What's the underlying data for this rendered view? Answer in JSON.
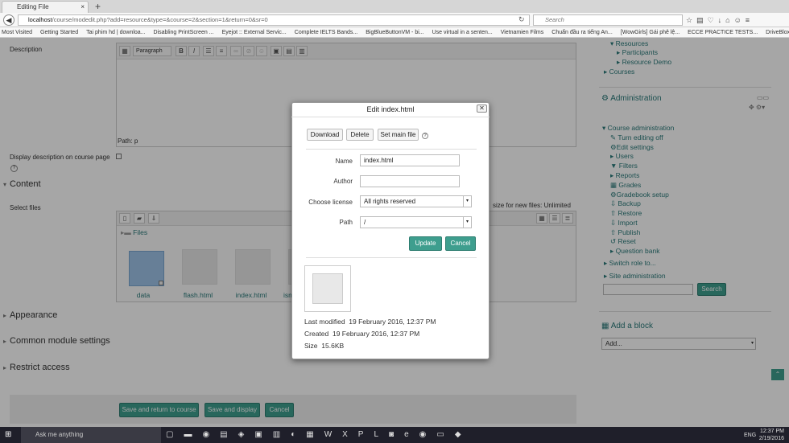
{
  "browser": {
    "tab_title": "Editing File",
    "tab_close": "×",
    "new_tab": "+",
    "url_host": "localhost",
    "url_path": "/course/modedit.php?add=resource&type=&course=2&section=1&return=0&sr=0",
    "search_placeholder": "Search",
    "bookmarks": [
      "Most Visited",
      "Getting Started",
      "Tai phim hd | downloa...",
      "Disabling PrintScreen ...",
      "Eyejot :: External Servic...",
      "Complete IELTS Bands...",
      "BigBlueButtonVM - bi...",
      "Use virtual in a senten...",
      "Vietnamien Films",
      "Chuẩn đầu ra tiếng An...",
      "[WowGirls] Gái phê lệ...",
      "ECCE PRACTICE TESTS...",
      "DriveBlox Unlimited, a ..."
    ]
  },
  "form": {
    "description_label": "Description",
    "paragraph_select": "Paragraph",
    "editor_path": "Path: p",
    "display_desc_label": "Display description on course page",
    "content_heading": "Content",
    "select_files_label": "Select files",
    "max_size_text": "size for new files: Unlimited",
    "files_folder": "Files",
    "files": [
      {
        "name": "data",
        "kind": "folder"
      },
      {
        "name": "flash.html",
        "kind": "file"
      },
      {
        "name": "index.html",
        "kind": "file"
      },
      {
        "name": "ism",
        "kind": "file"
      }
    ],
    "appearance_heading": "Appearance",
    "common_module_heading": "Common module settings",
    "restrict_heading": "Restrict access",
    "save_return_label": "Save and return to course",
    "save_display_label": "Save and display",
    "cancel_label": "Cancel"
  },
  "sidebar": {
    "resources": "Resources",
    "participants": "Participants",
    "resource_demo": "Resource Demo",
    "courses": "Courses",
    "admin_title": "Administration",
    "course_admin": "Course administration",
    "items": [
      "Turn editing off",
      "Edit settings",
      "Users",
      "Filters",
      "Reports",
      "Grades",
      "Gradebook setup",
      "Backup",
      "Restore",
      "Import",
      "Publish",
      "Reset",
      "Question bank"
    ],
    "switch_role": "Switch role to...",
    "site_admin": "Site administration",
    "search_button": "Search",
    "add_block_title": "Add a block",
    "add_block_select": "Add..."
  },
  "dialog": {
    "title": "Edit index.html",
    "download_label": "Download",
    "delete_label": "Delete",
    "set_main_label": "Set main file",
    "name_label": "Name",
    "name_value": "index.html",
    "author_label": "Author",
    "author_value": "",
    "license_label": "Choose license",
    "license_value": "All rights reserved",
    "path_label": "Path",
    "path_value": "/",
    "update_label": "Update",
    "cancel_label": "Cancel",
    "last_modified_label": "Last modified",
    "last_modified_value": "19 February 2016, 12:37 PM",
    "created_label": "Created",
    "created_value": "19 February 2016, 12:37 PM",
    "size_label": "Size",
    "size_value": "15.6KB"
  },
  "taskbar": {
    "cortana_placeholder": "Ask me anything",
    "lang": "ENG",
    "time": "12:37 PM",
    "date": "2/19/2016"
  }
}
